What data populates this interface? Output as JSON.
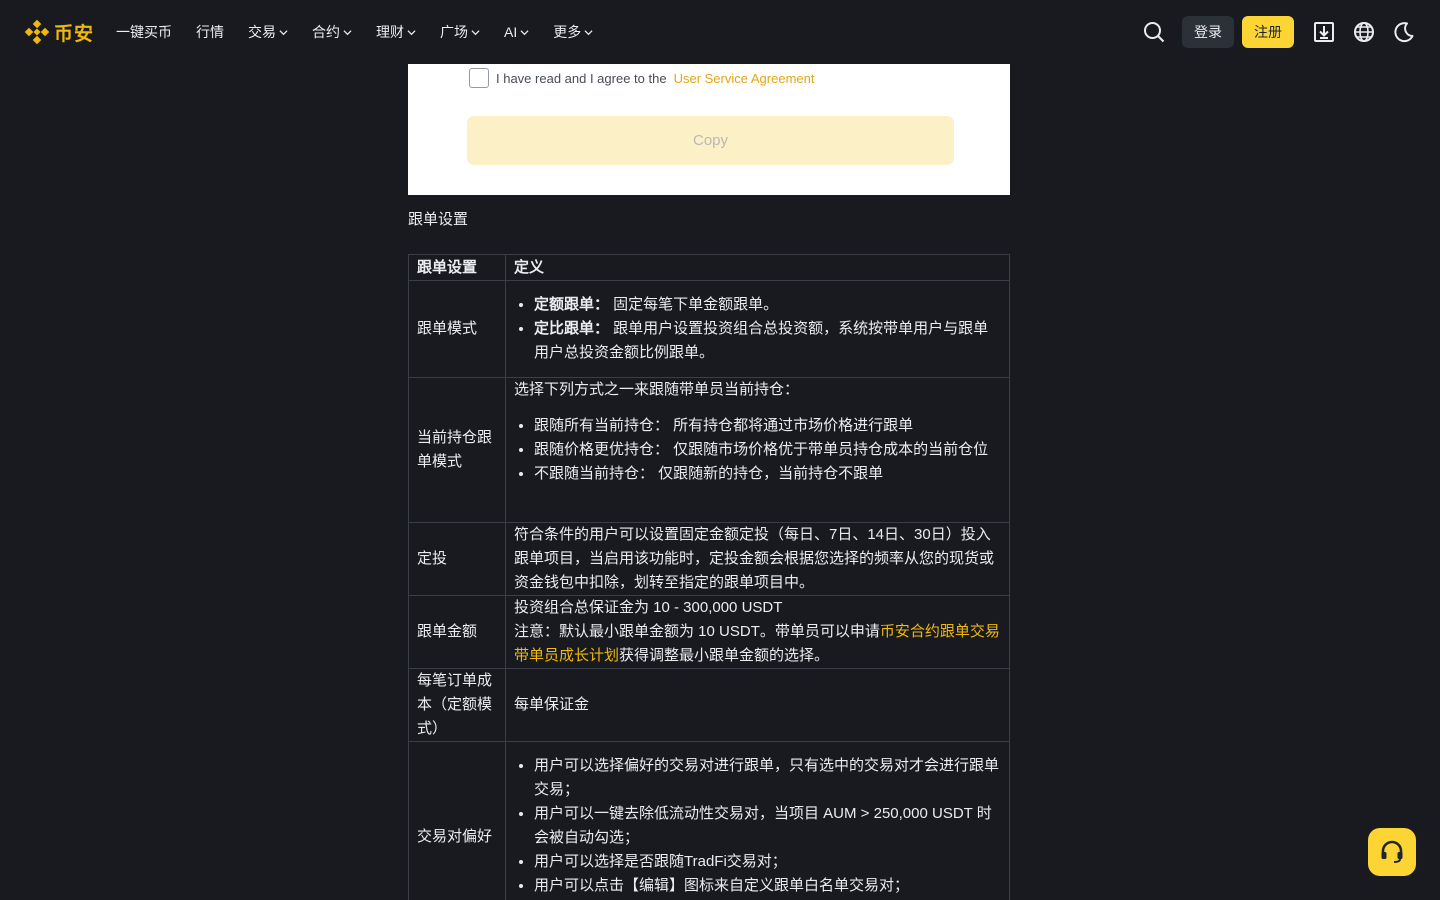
{
  "nav": {
    "logo_text": "币安",
    "items": [
      "一键买币",
      "行情",
      "交易",
      "合约",
      "理财",
      "广场",
      "AI",
      "更多"
    ],
    "login": "登录",
    "register": "注册"
  },
  "screenshot": {
    "agree_text": "I have read and I agree to the",
    "agree_link": "User Service Agreement",
    "copy_button": "Copy"
  },
  "section_title": "跟单设置",
  "table": {
    "headers": [
      "跟单设置",
      "定义"
    ],
    "rows": {
      "mode": {
        "label": "跟单模式",
        "b1_bold": "定额跟单：",
        "b1_text": " 固定每笔下单金额跟单。",
        "b2_bold": "定比跟单：",
        "b2_text": " 跟单用户设置投资组合总投资额，系统按带单用户与跟单用户总投资金额比例跟单。"
      },
      "position": {
        "label": "当前持仓跟单模式",
        "intro": "选择下列方式之一来跟随带单员当前持仓：",
        "b1": "跟随所有当前持仓： 所有持仓都将通过市场价格进行跟单",
        "b2": "跟随价格更优持仓： 仅跟随市场价格优于带单员持仓成本的当前仓位",
        "b3": "不跟随当前持仓： 仅跟随新的持仓，当前持仓不跟单"
      },
      "dca": {
        "label": "定投",
        "text": "符合条件的用户可以设置固定金额定投（每日、7日、14日、30日）投入跟单项目，当启用该功能时，定投金额会根据您选择的频率从您的现货或资金钱包中扣除，划转至指定的跟单项目中。"
      },
      "amount": {
        "label": "跟单金额",
        "line1": "投资组合总保证金为 10 - 300,000 USDT",
        "note_pre": "注意：默认最小跟单金额为 10 USDT。带单员可以申请",
        "note_link": "币安合约跟单交易带单员成长计划",
        "note_post": "获得调整最小跟单金额的选择。"
      },
      "cost": {
        "label": "每笔订单成本（定额模式）",
        "text": "每单保证金"
      },
      "pairs": {
        "label": "交易对偏好",
        "b1": "用户可以选择偏好的交易对进行跟单，只有选中的交易对才会进行跟单交易；",
        "b2": "用户可以一键去除低流动性交易对，当项目 AUM > 250,000 USDT 时会被自动勾选；",
        "b3": "用户可以选择是否跟随TradFi交易对；",
        "b4": "用户可以点击【编辑】图标来自定义跟单白名单交易对；"
      }
    }
  },
  "colors": {
    "accent": "#f0b90b",
    "background": "#181a20",
    "button_primary": "#fcd535"
  },
  "icons": [
    "binance-logo-icon",
    "chevron-down-icon",
    "search-icon",
    "download-icon",
    "globe-icon",
    "moon-icon",
    "headset-icon"
  ]
}
